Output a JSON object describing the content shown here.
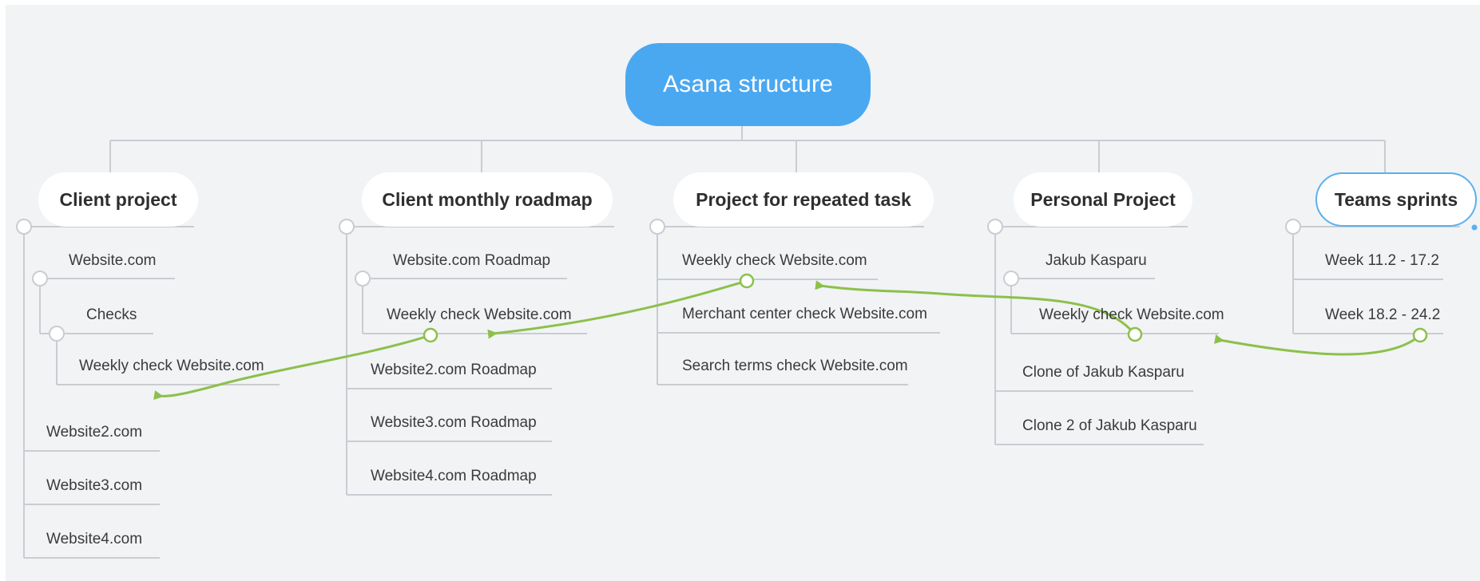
{
  "root": {
    "label": "Asana structure"
  },
  "topics": {
    "client_project": {
      "title": "Client project",
      "items": {
        "website": "Website.com",
        "checks": "Checks",
        "weekly_check": "Weekly check Website.com",
        "website2": "Website2.com",
        "website3": "Website3.com",
        "website4": "Website4.com"
      }
    },
    "client_monthly_roadmap": {
      "title": "Client monthly roadmap",
      "items": {
        "website_roadmap": "Website.com Roadmap",
        "weekly_check": "Weekly check Website.com",
        "website2_roadmap": "Website2.com Roadmap",
        "website3_roadmap": "Website3.com Roadmap",
        "website4_roadmap": "Website4.com Roadmap"
      }
    },
    "project_repeated_task": {
      "title": "Project for repeated task",
      "items": {
        "weekly_check": "Weekly check Website.com",
        "merchant_center": "Merchant center check Website.com",
        "search_terms": "Search terms check Website.com"
      }
    },
    "personal_project": {
      "title": "Personal Project",
      "items": {
        "jakub": "Jakub Kasparu",
        "weekly_check": "Weekly check Website.com",
        "clone1": "Clone of Jakub Kasparu",
        "clone2": "Clone 2 of Jakub Kasparu"
      }
    },
    "teams_sprints": {
      "title": "Teams sprints",
      "items": {
        "week1": "Week 11.2 - 17.2",
        "week2": "Week 18.2 - 24.2"
      }
    }
  },
  "colors": {
    "canvas": "#f1f3f5",
    "root_fill": "#4aa8f1",
    "connector": "#c9cdd2",
    "relationship_arrow": "#8cc04b",
    "selected_border": "#5ab0ee"
  }
}
